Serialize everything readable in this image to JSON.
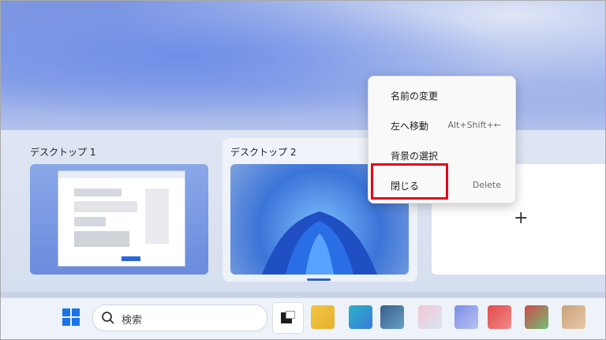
{
  "desktops": [
    {
      "label": "デスクトップ 1"
    },
    {
      "label": "デスクトップ 2"
    }
  ],
  "new_desktop": {
    "icon": "plus-icon",
    "symbol": "+"
  },
  "context_menu": {
    "items": [
      {
        "label": "名前の変更",
        "shortcut": ""
      },
      {
        "label": "左へ移動",
        "shortcut": "Alt+Shift+←"
      },
      {
        "label": "背景の選択",
        "shortcut": ""
      },
      {
        "label": "閉じる",
        "shortcut": "Delete"
      }
    ],
    "highlight_color": "#e3001b"
  },
  "taskbar": {
    "start_icon": "windows-start-icon",
    "search_placeholder": "検索",
    "accent": "#1a73e8"
  }
}
